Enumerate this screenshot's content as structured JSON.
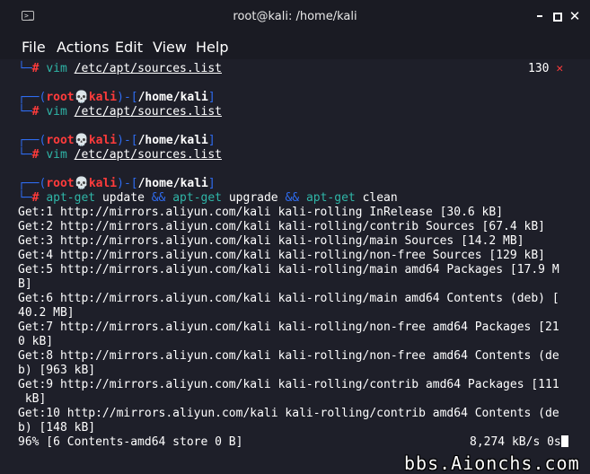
{
  "window": {
    "title": "root@kali: /home/kali",
    "terminal_icon_glyph": ">_",
    "close_glyph": "✕"
  },
  "menu": {
    "file": "File",
    "actions": "Actions",
    "edit": "Edit",
    "view": "View",
    "help": "Help"
  },
  "prompt": {
    "corner_top": "┌──(",
    "user": "root",
    "skull": "💀",
    "host": "kali",
    "mid": ")-[",
    "path": "/home/kali",
    "end": "]",
    "corner_bottom": "└─",
    "hash": "#"
  },
  "entries": [
    {
      "cmd": "vim",
      "arg": "/etc/apt/sources.list",
      "exit_code": "130",
      "exit_mark": "✕"
    },
    {
      "cmd": "vim",
      "arg": "/etc/apt/sources.list"
    },
    {
      "cmd": "vim",
      "arg": "/etc/apt/sources.list"
    }
  ],
  "last_command": {
    "c1": "apt-get",
    "a1": "update",
    "op1": "&&",
    "c2": "apt-get",
    "a2": "upgrade",
    "op2": "&&",
    "c3": "apt-get",
    "a3": "clean"
  },
  "output": [
    "Get:1 http://mirrors.aliyun.com/kali kali-rolling InRelease [30.6 kB]",
    "Get:2 http://mirrors.aliyun.com/kali kali-rolling/contrib Sources [67.4 kB]",
    "Get:3 http://mirrors.aliyun.com/kali kali-rolling/main Sources [14.2 MB]",
    "Get:4 http://mirrors.aliyun.com/kali kali-rolling/non-free Sources [129 kB]",
    "Get:5 http://mirrors.aliyun.com/kali kali-rolling/main amd64 Packages [17.9 M",
    "B]",
    "Get:6 http://mirrors.aliyun.com/kali kali-rolling/main amd64 Contents (deb) [",
    "40.2 MB]",
    "Get:7 http://mirrors.aliyun.com/kali kali-rolling/non-free amd64 Packages [21",
    "0 kB]",
    "Get:8 http://mirrors.aliyun.com/kali kali-rolling/non-free amd64 Contents (de",
    "b) [963 kB]",
    "Get:9 http://mirrors.aliyun.com/kali kali-rolling/contrib amd64 Packages [111",
    " kB]",
    "Get:10 http://mirrors.aliyun.com/kali kali-rolling/contrib amd64 Contents (de",
    "b) [148 kB]"
  ],
  "progress": {
    "left": "96% [6 Contents-amd64 store 0 B]",
    "right": "8,274 kB/s 0s"
  },
  "watermark": "bbs.Aionchs.com"
}
